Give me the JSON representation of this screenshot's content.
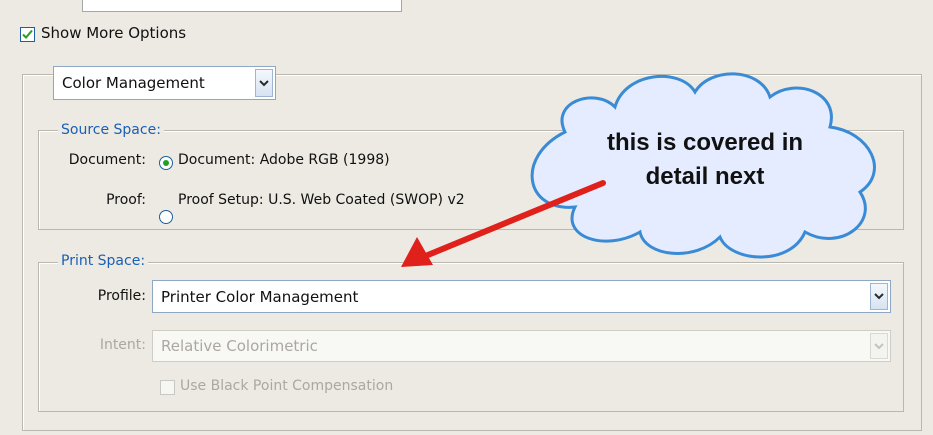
{
  "show_more_options": {
    "label": "Show More Options",
    "checked": true
  },
  "section_select": {
    "value": "Color Management"
  },
  "source_space": {
    "legend": "Source Space:",
    "document": {
      "label": "Document:",
      "option": "Document:  Adobe RGB (1998)",
      "selected": true
    },
    "proof": {
      "label": "Proof:",
      "option": "Proof Setup:  U.S. Web Coated (SWOP) v2",
      "selected": false
    }
  },
  "print_space": {
    "legend": "Print Space:",
    "profile": {
      "label": "Profile:",
      "value": "Printer Color Management"
    },
    "intent": {
      "label": "Intent:",
      "value": "Relative Colorimetric",
      "disabled": true
    },
    "black_point": {
      "label": "Use Black Point Compensation",
      "checked": false,
      "disabled": true
    }
  },
  "annotation": {
    "callout_text": "this is covered in detail next",
    "arrow_color": "#e0201a",
    "cloud_fill": "#e6ecff",
    "cloud_stroke": "#3a8bd6"
  },
  "colors": {
    "accent_blue": "#1a5fb4",
    "check_green": "#21a121",
    "panel_bg": "#eceae3"
  }
}
